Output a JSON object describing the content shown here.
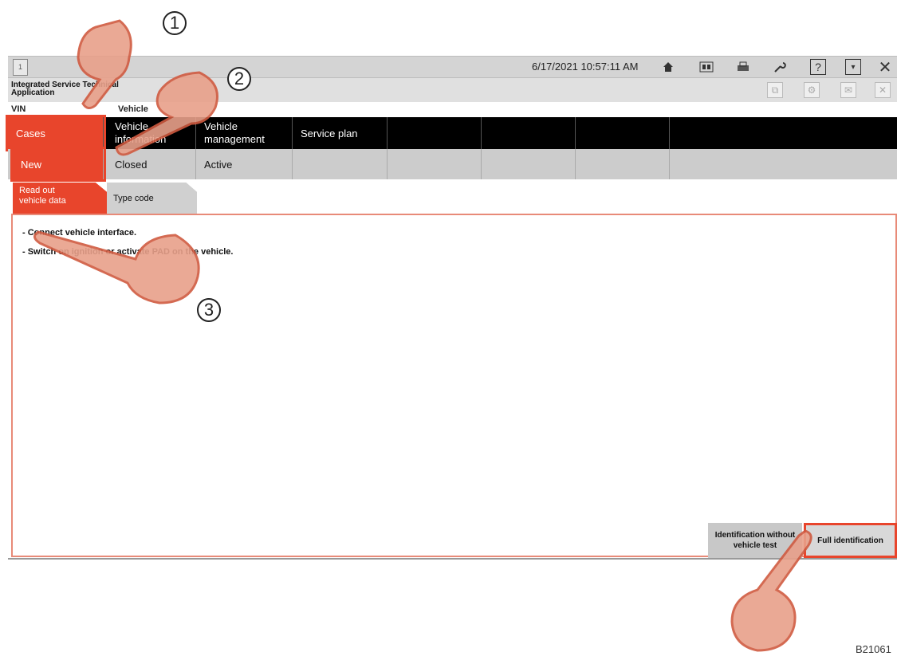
{
  "topbar": {
    "window_number": "1",
    "datetime": "6/17/2021 10:57:11 AM",
    "icons": [
      "home-icon",
      "display-icon",
      "printer-icon",
      "wrench-icon",
      "help-icon",
      "minimize-icon",
      "close-icon"
    ]
  },
  "appbar": {
    "title": "Integrated Service Technical Application",
    "icons": [
      "copy-icon",
      "settings-icon",
      "mail-icon",
      "close-icon"
    ]
  },
  "labels": {
    "vin": "VIN",
    "vehicle": "Vehicle"
  },
  "nav": [
    {
      "label": "Cases",
      "active": true
    },
    {
      "label": "Vehicle information",
      "active": false
    },
    {
      "label": "Vehicle management",
      "active": false
    },
    {
      "label": "Service plan",
      "active": false
    }
  ],
  "subnav": [
    {
      "label": "New",
      "active": true
    },
    {
      "label": "Closed",
      "active": false
    },
    {
      "label": "Active",
      "active": false
    }
  ],
  "tabs": [
    {
      "label": "Read out vehicle data",
      "active": true
    },
    {
      "label": "Type code",
      "active": false
    }
  ],
  "instructions": [
    "- Connect vehicle interface.",
    "- Switch on ignition or activate PAD on the vehicle."
  ],
  "buttons": {
    "no_test": "Identification without vehicle test",
    "full": "Full identification"
  },
  "steps": [
    "1",
    "2",
    "3"
  ],
  "reference_code": "B21061",
  "colors": {
    "accent": "#e8452c",
    "nav_bg": "#000000",
    "subnav_bg": "#cccccc"
  }
}
